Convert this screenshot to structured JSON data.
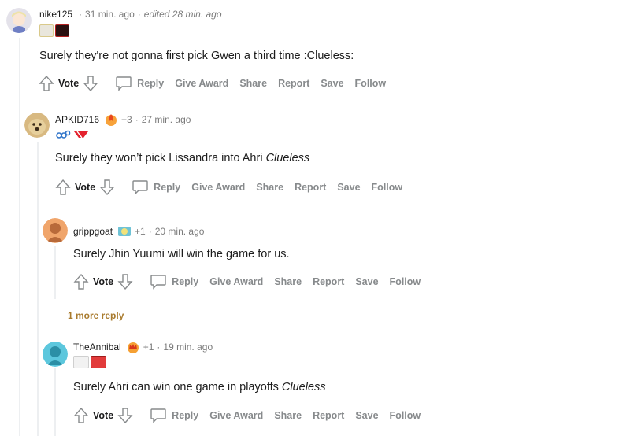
{
  "comments": [
    {
      "username": "nike125",
      "karma": "",
      "time": "31 min. ago",
      "edited": "edited 28 min. ago",
      "text_plain": "Surely they're not gonna first pick Gwen a third time :Clueless:",
      "text_italic": "",
      "avatar_color": "#d7d7df"
    },
    {
      "username": "APKID716",
      "karma": "+3",
      "time": "27 min. ago",
      "edited": "",
      "text_plain": "Surely they won’t pick Lissandra into Ahri ",
      "text_italic": "Clueless",
      "avatar_color": "#c9a46b"
    },
    {
      "username": "grippgoat",
      "karma": "+1",
      "time": "20 min. ago",
      "edited": "",
      "text_plain": "Surely Jhin Yuumi will win the game for us.",
      "text_italic": "",
      "avatar_color": "#e08a4c"
    },
    {
      "username": "TheAnnibal",
      "karma": "+1",
      "time": "19 min. ago",
      "edited": "",
      "text_plain": "Surely Ahri can win one game in playoffs ",
      "text_italic": "Clueless",
      "avatar_color": "#4fbfd8"
    }
  ],
  "actions": {
    "vote": "Vote",
    "reply": "Reply",
    "give_award": "Give Award",
    "share": "Share",
    "report": "Report",
    "save": "Save",
    "follow": "Follow"
  },
  "more_replies": "1 more reply",
  "colors": {
    "accent_more": "#a97b2e",
    "muted": "#878a8c",
    "thread": "#edeff1"
  }
}
